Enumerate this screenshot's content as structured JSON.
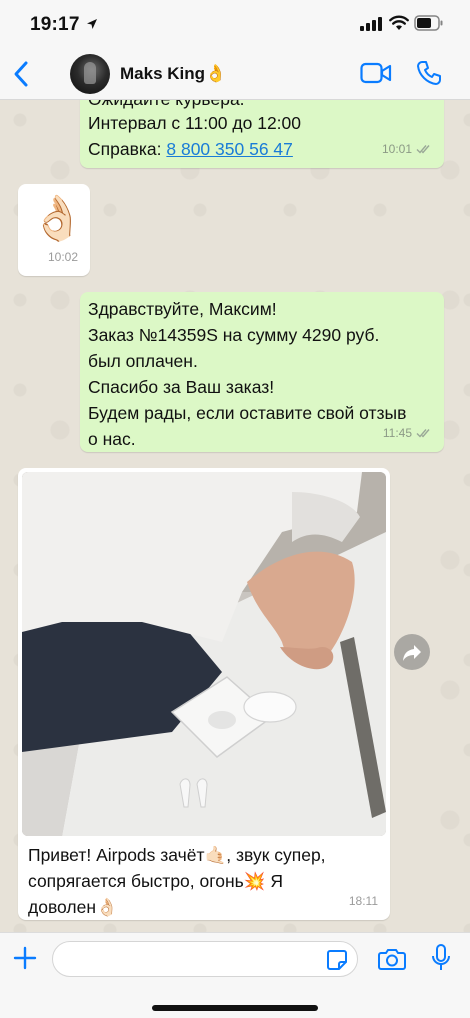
{
  "status": {
    "time": "19:17"
  },
  "header": {
    "contact_name": "Maks King👌"
  },
  "messages": {
    "m1": {
      "line_cut": "Ожидайте курьера.",
      "line1": "Интервал с 11:00 до 12:00",
      "line2_prefix": "Справка: ",
      "phone": "8 800 350 56 47",
      "time": "10:01"
    },
    "m2": {
      "emoji": "👌🏻",
      "time": "10:02"
    },
    "m3": {
      "line1": "Здравствуйте, Максим!",
      "line2": "Заказ №14359S на сумму 4290 руб.",
      "line3": "был оплачен.",
      "line4": "Спасибо за Ваш заказ!",
      "line5": "Будем рады, если оставите свой отзыв",
      "line6": "о нас.",
      "time": "11:45"
    },
    "m4": {
      "caption_line1": "Привет! Airpods зачёт🤙🏻, звук супер,",
      "caption_line2": "сопрягается быстро, огонь💥 Я",
      "caption_line3": "доволен👌🏻",
      "time": "18:11"
    }
  },
  "input": {
    "placeholder": ""
  },
  "colors": {
    "accent": "#0a7cff",
    "outgoing_bubble": "#dcf8c6",
    "incoming_bubble": "#ffffff",
    "chat_background": "#e7e2d8"
  },
  "icons": [
    "location-arrow-icon",
    "signal-icon",
    "wifi-icon",
    "battery-icon",
    "back-chevron-icon",
    "video-call-icon",
    "phone-call-icon",
    "double-check-icon",
    "forward-icon",
    "plus-icon",
    "sticker-icon",
    "camera-icon",
    "microphone-icon"
  ]
}
